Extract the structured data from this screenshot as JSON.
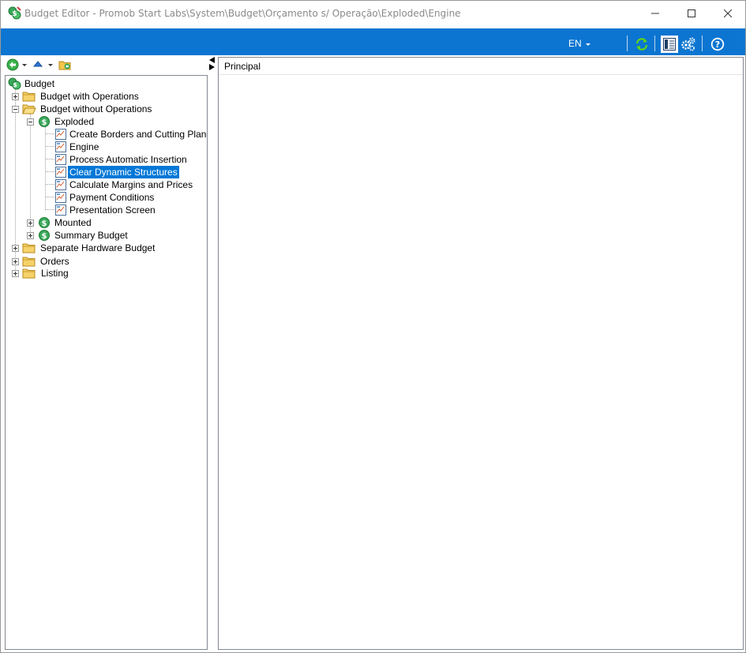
{
  "window": {
    "title": "Budget Editor - Promob Start Labs\\System\\Budget\\Orçamento s/ Operação\\Exploded\\Engine",
    "minimize_icon": "minimize-icon",
    "maximize_icon": "maximize-icon",
    "close_icon": "close-icon"
  },
  "toolbar": {
    "language": "EN",
    "icons": [
      "refresh-icon",
      "layout-panel-icon",
      "settings-gears-icon",
      "help-icon"
    ],
    "accent_color": "#0b75d1"
  },
  "nav": {
    "icons": [
      "back-arrow-icon",
      "up-arrow-icon",
      "open-folder-icon"
    ]
  },
  "tree": {
    "root": "Budget",
    "items": [
      {
        "label": "Budget with Operations"
      },
      {
        "label": "Budget without Operations"
      },
      {
        "label": "Exploded"
      },
      {
        "label": "Create Borders and Cutting Plane"
      },
      {
        "label": "Engine"
      },
      {
        "label": "Process Automatic Insertion"
      },
      {
        "label": "Clear Dynamic Structures"
      },
      {
        "label": "Calculate Margins and Prices"
      },
      {
        "label": "Payment Conditions"
      },
      {
        "label": "Presentation Screen"
      },
      {
        "label": "Mounted"
      },
      {
        "label": "Summary Budget"
      },
      {
        "label": "Separate Hardware Budget"
      },
      {
        "label": "Orders"
      },
      {
        "label": "Listing"
      }
    ],
    "selected": "Clear Dynamic Structures",
    "selection_color": "#0078d7"
  },
  "main": {
    "tab_label": "Principal"
  }
}
